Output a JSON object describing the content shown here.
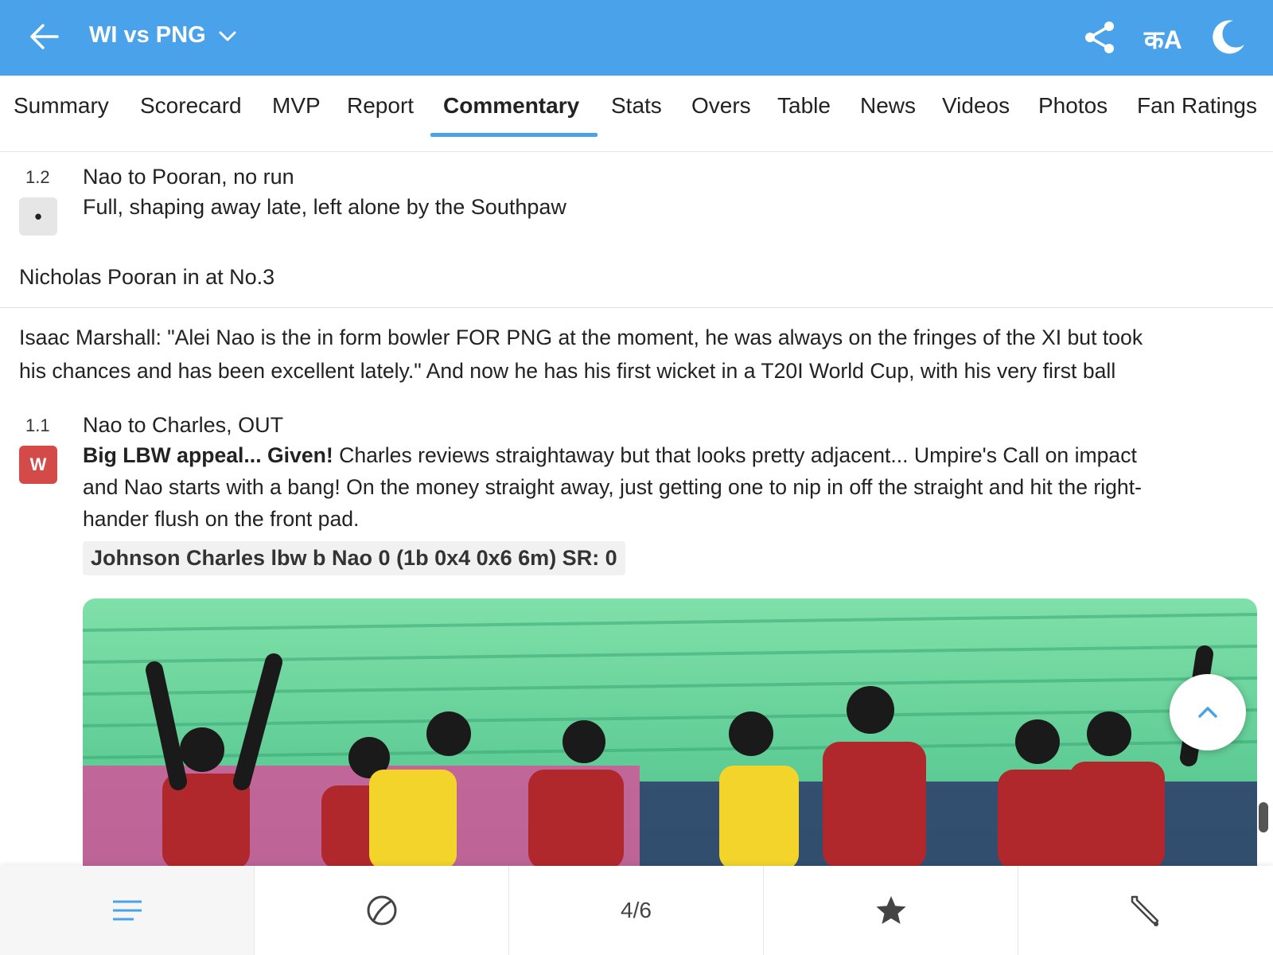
{
  "header": {
    "title": "WI vs PNG",
    "lang_label": "कA"
  },
  "tabs": [
    {
      "label": "Summary"
    },
    {
      "label": "Scorecard"
    },
    {
      "label": "MVP"
    },
    {
      "label": "Report"
    },
    {
      "label": "Commentary",
      "active": true
    },
    {
      "label": "Stats"
    },
    {
      "label": "Overs"
    },
    {
      "label": "Table"
    },
    {
      "label": "News"
    },
    {
      "label": "Videos"
    },
    {
      "label": "Photos"
    },
    {
      "label": "Fan Ratings"
    }
  ],
  "commentary": {
    "ball_1_2": {
      "over": "1.2",
      "result": "•",
      "headline": "Nao to Pooran, no run",
      "text": "Full, shaping away late, left alone by the Southpaw"
    },
    "batter_in": "Nicholas Pooran in at No.3",
    "quote_line1": "Isaac Marshall: \"Alei Nao is the in form bowler FOR PNG at the moment, he was always on the fringes of the XI but took",
    "quote_line2": "his chances and has been excellent lately.\" And now he has his first wicket in a T20I World Cup, with his very first ball",
    "ball_1_1": {
      "over": "1.1",
      "result": "W",
      "headline": "Nao to Charles, OUT",
      "bold_lead": "Big LBW appeal... Given!",
      "text_line1": " Charles reviews straightaway but that looks pretty adjacent... Umpire's Call on impact",
      "text_line2": "and Nao starts with a bang! On the money straight away, just getting one to nip in off the straight and hit the right-",
      "text_line3": "hander flush on the front pad.",
      "dismissal": "Johnson Charles lbw b Nao 0 (1b 0x4 0x6 6m) SR: 0"
    }
  },
  "bottom_nav": {
    "pager": "4/6"
  },
  "colors": {
    "brand": "#4aa3ea",
    "wicket": "#d44a48"
  }
}
